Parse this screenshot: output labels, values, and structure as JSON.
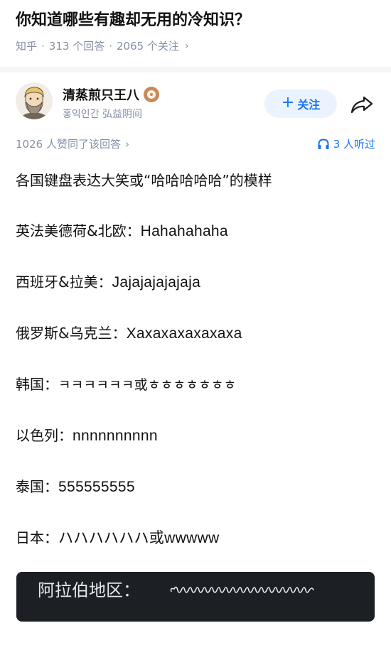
{
  "question": {
    "title": "你知道哪些有趣却无用的冷知识？",
    "source": "知乎",
    "answers": "313 个回答",
    "followers": "2065 个关注",
    "separator": "·",
    "chevron": "›"
  },
  "author": {
    "name": "清蒸煎只王八",
    "bio": "홍익인간 弘益阴间",
    "follow_label": "关注",
    "follow_plus": "+",
    "avatar_icon": "bearded-man-avatar",
    "badge_icon": "eye-badge-icon"
  },
  "stats": {
    "upvotes": "1026 人赞同了该回答",
    "chevron": "›",
    "listeners": "3 人听过",
    "accent": "#1772f6"
  },
  "content": {
    "intro": "各国键盘表达大笑或“哈哈哈哈哈”的模样",
    "lines": [
      {
        "label": "英法美德荷&北欧：",
        "value": "Hahahahaha"
      },
      {
        "label": "西班牙&拉美：",
        "value": "Jajajajajajaja"
      },
      {
        "label": "俄罗斯&乌克兰：",
        "value": "Xaxaxaxaxaxaxa"
      },
      {
        "label": "韩国：",
        "value": "ㅋㅋㅋㅋㅋㅋ或ㅎㅎㅎㅎㅎㅎㅎ"
      },
      {
        "label": "以色列：",
        "value": "nnnnnnnnnn"
      },
      {
        "label": "泰国：",
        "value": "555555555"
      },
      {
        "label": "日本：",
        "value": "ハハハハハハ或wwwww"
      }
    ],
    "arabic_label": "阿拉伯地区："
  }
}
